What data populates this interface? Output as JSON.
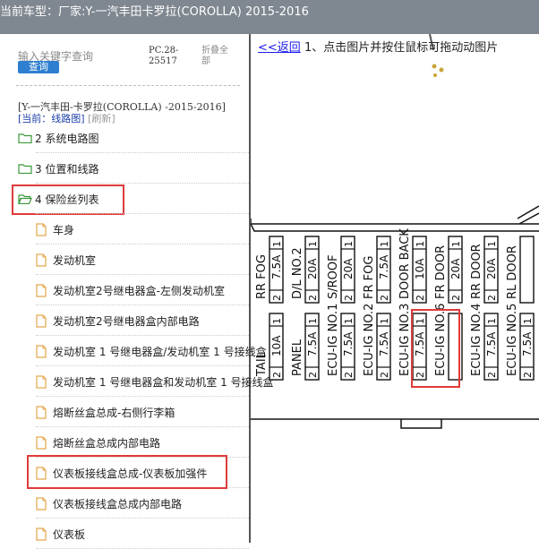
{
  "header": {
    "title": "当前车型：厂家:Y-一汽丰田卡罗拉(COROLLA) 2015-2016"
  },
  "sidebar": {
    "search": {
      "placeholder": "输入关键字查询",
      "button": "查询"
    },
    "pc_code_line1": "PC.28-",
    "pc_code_line2": "25517",
    "collapse_line1": "折叠全",
    "collapse_line2": "部",
    "path": "[Y-一汽丰田-卡罗拉(COROLLA) -2015-2016]",
    "current_label": "[当前：线路图]",
    "refresh": "[刷新]",
    "folders": [
      {
        "label": "2 系统电路图"
      },
      {
        "label": "3 位置和线路"
      },
      {
        "label": "4 保险丝列表"
      }
    ],
    "items": [
      {
        "label": "车身"
      },
      {
        "label": "发动机室"
      },
      {
        "label": "发动机室2号继电器盒-左侧发动机室"
      },
      {
        "label": "发动机室2号继电器盒内部电路"
      },
      {
        "label": "发动机室 1 号继电器盒/发动机室 1 号接线盒"
      },
      {
        "label": "发动机室 1 号继电器盒和发动机室 1 号接线盒"
      },
      {
        "label": "熔断丝盒总成-右侧行李箱"
      },
      {
        "label": "熔断丝盒总成内部电路"
      },
      {
        "label": "仪表板接线盒总成-仪表板加强件"
      },
      {
        "label": "仪表板接线盒总成内部电路"
      },
      {
        "label": "仪表板"
      }
    ]
  },
  "viewer": {
    "back": "<<返回",
    "hint": "1、点击图片并按住鼠标可拖动动图片",
    "fuses_top": [
      {
        "name": "RR FOG",
        "amp": "7.5A",
        "pin": "1",
        "pin2": "2"
      },
      {
        "name": "D/L NO.2",
        "amp": "20A",
        "pin": "1",
        "pin2": "2"
      },
      {
        "name": "S/ROOF",
        "amp": "20A",
        "pin": "1",
        "pin2": "2"
      },
      {
        "name": "FR FOG",
        "amp": "7.5A",
        "pin": "1",
        "pin2": "2"
      },
      {
        "name": "DOOR BACK",
        "amp": "10A",
        "pin": "1",
        "pin2": "2"
      },
      {
        "name": "FR DOOR",
        "amp": "20A",
        "pin": "1",
        "pin2": "2"
      },
      {
        "name": "RR DOOR",
        "amp": "20A",
        "pin": "1",
        "pin2": "2"
      },
      {
        "name": "RL DOOR",
        "amp": "",
        "pin": "",
        "pin2": ""
      }
    ],
    "fuses_bottom": [
      {
        "name": "TAIL",
        "amp": "10A",
        "pin": "1",
        "pin2": "2"
      },
      {
        "name": "PANEL",
        "amp": "7.5A",
        "pin": "1",
        "pin2": "2"
      },
      {
        "name": "ECU-IG NO.1",
        "amp": "7.5A",
        "pin": "1",
        "pin2": "2"
      },
      {
        "name": "ECU-IG NO.2",
        "amp": "7.5A",
        "pin": "1",
        "pin2": "2"
      },
      {
        "name": "ECU-IG NO.3",
        "amp": "7.5A",
        "pin": "1",
        "pin2": "2"
      },
      {
        "name": "ECU-IG NO.6",
        "amp": "",
        "pin": "",
        "pin2": ""
      },
      {
        "name": "ECU-IG NO.4",
        "amp": "7.5A",
        "pin": "1",
        "pin2": "2"
      },
      {
        "name": "ECU-IG NO.5",
        "amp": "7.5A",
        "pin": "1",
        "pin2": "2"
      }
    ]
  },
  "colors": {
    "highlight": "#e03a3a",
    "button": "#2e7fcf",
    "header_bg": "#7f8790"
  }
}
